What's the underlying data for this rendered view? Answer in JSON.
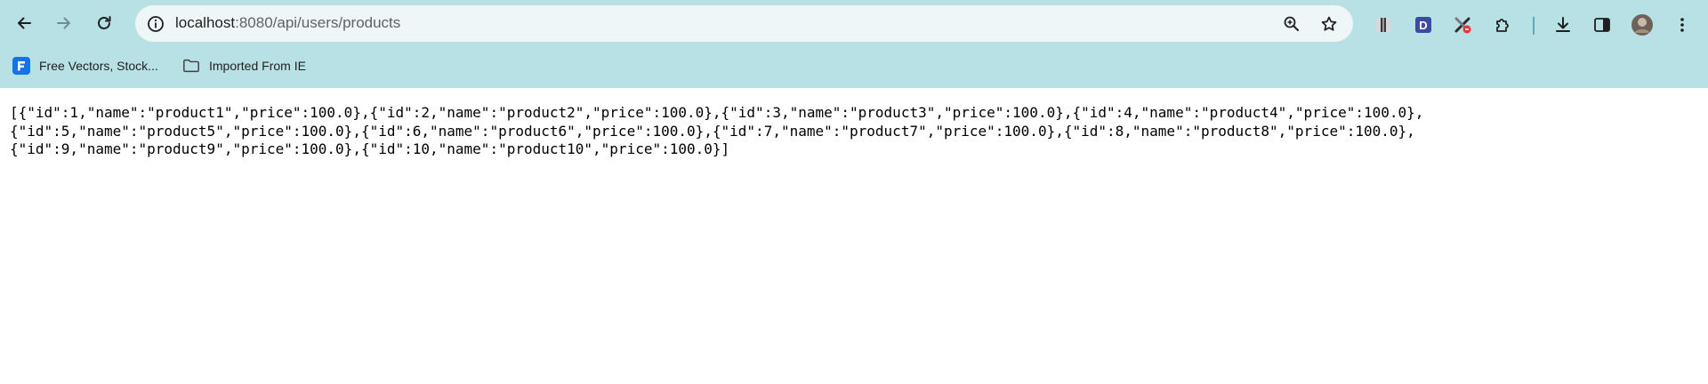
{
  "browser": {
    "omnibox": {
      "host": "localhost",
      "path": ":8080/api/users/products"
    },
    "bookmarks": [
      {
        "label": "Free Vectors, Stock...",
        "icon": "freepik-icon"
      },
      {
        "label": "Imported From IE",
        "icon": "folder-icon"
      }
    ],
    "extensions": [
      {
        "name": "ruler-extension-icon"
      },
      {
        "name": "d-extension-icon"
      },
      {
        "name": "tools-extension-icon"
      },
      {
        "name": "puzzle-extensions-icon"
      }
    ],
    "accent_color": "#b8e1e6"
  },
  "page": {
    "json_lines": [
      "[{\"id\":1,\"name\":\"product1\",\"price\":100.0},{\"id\":2,\"name\":\"product2\",\"price\":100.0},{\"id\":3,\"name\":\"product3\",\"price\":100.0},{\"id\":4,\"name\":\"product4\",\"price\":100.0},",
      "{\"id\":5,\"name\":\"product5\",\"price\":100.0},{\"id\":6,\"name\":\"product6\",\"price\":100.0},{\"id\":7,\"name\":\"product7\",\"price\":100.0},{\"id\":8,\"name\":\"product8\",\"price\":100.0},",
      "{\"id\":9,\"name\":\"product9\",\"price\":100.0},{\"id\":10,\"name\":\"product10\",\"price\":100.0}]"
    ]
  }
}
